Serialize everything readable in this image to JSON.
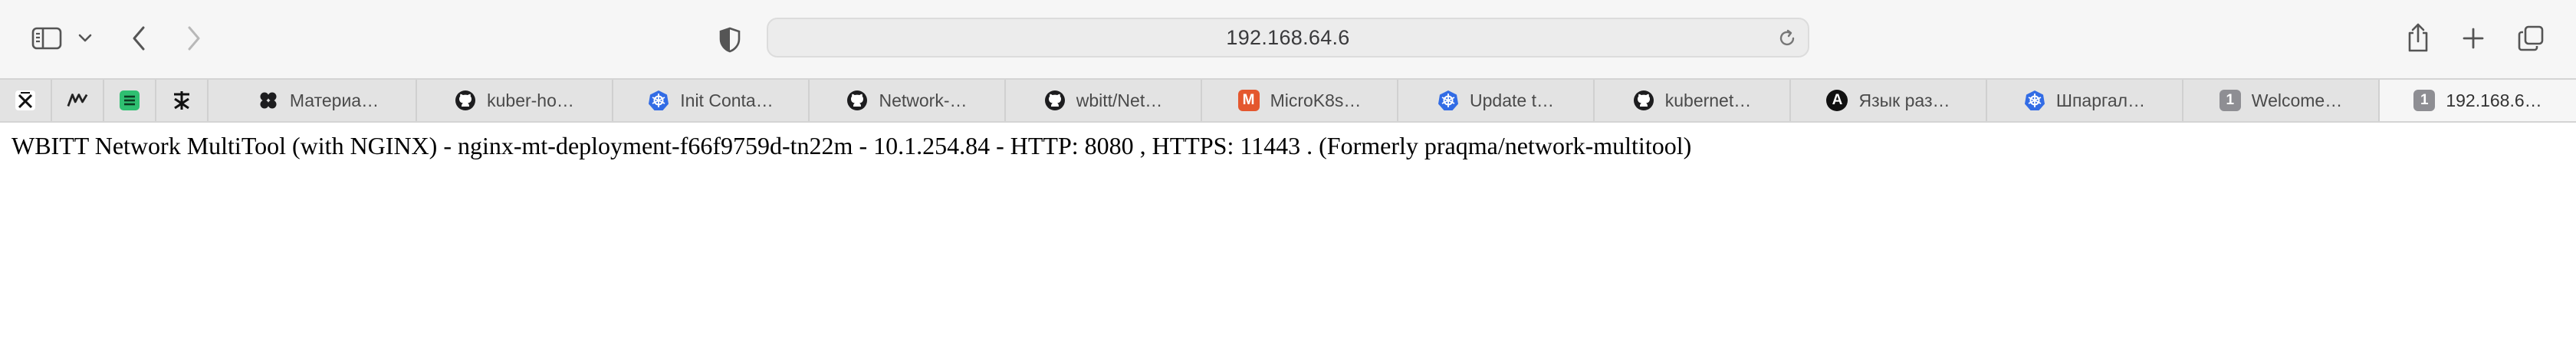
{
  "browser": {
    "url": "192.168.64.6",
    "icons": [
      "sidebar-icon",
      "chevron-down-icon",
      "back-icon",
      "forward-icon",
      "privacy-shield-icon",
      "reload-icon",
      "share-icon",
      "new-tab-icon",
      "tab-overview-icon"
    ]
  },
  "pinned_tabs": [
    {
      "icon": "x-mark-icon"
    },
    {
      "icon": "m-logo-icon"
    },
    {
      "icon": "menu-lines-icon"
    },
    {
      "icon": "cross-icon"
    }
  ],
  "tabs": [
    {
      "label": "Материа…",
      "icon": "clover-icon",
      "color": "#1d1d1f"
    },
    {
      "label": "kuber-ho…",
      "icon": "github-icon",
      "color": "#1d1d1f"
    },
    {
      "label": "Init Conta…",
      "icon": "kubernetes-icon",
      "color": "#326ce5"
    },
    {
      "label": "Network-…",
      "icon": "github-icon",
      "color": "#1d1d1f"
    },
    {
      "label": "wbitt/Net…",
      "icon": "github-icon",
      "color": "#1d1d1f"
    },
    {
      "label": "MicroK8s…",
      "icon": "m-badge-icon",
      "badge": "M",
      "color": "#e4572e"
    },
    {
      "label": "Update t…",
      "icon": "kubernetes-icon",
      "color": "#326ce5"
    },
    {
      "label": "kubernet…",
      "icon": "github-icon",
      "color": "#1d1d1f"
    },
    {
      "label": "Язык раз…",
      "icon": "a-badge-icon",
      "badge": "A",
      "color": "#111111"
    },
    {
      "label": "Шпаргал…",
      "icon": "kubernetes-icon",
      "color": "#326ce5"
    },
    {
      "label": "Welcome…",
      "icon": "number-badge-icon",
      "badge": "1",
      "color": "#8e8e93"
    },
    {
      "label": "192.168.6…",
      "icon": "number-badge-icon",
      "badge": "1",
      "color": "#8e8e93",
      "active": true
    }
  ],
  "page": {
    "text": "WBITT Network MultiTool (with NGINX) - nginx-mt-deployment-f66f9759d-tn22m - 10.1.254.84 - HTTP: 8080 , HTTPS: 11443 . (Formerly praqma/network-multitool)"
  }
}
